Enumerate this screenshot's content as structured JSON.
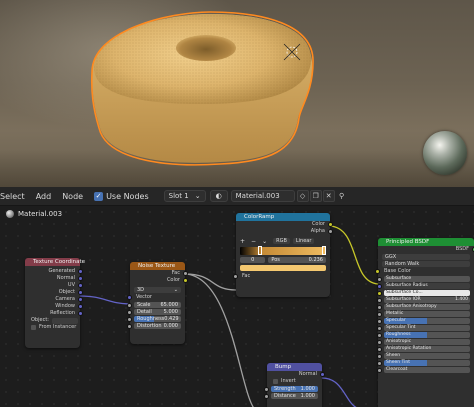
{
  "header": {
    "menus": [
      "Select",
      "Add",
      "Node"
    ],
    "use_nodes_label": "Use Nodes",
    "use_nodes_checked": true,
    "slot": "Slot 1",
    "material_name": "Material.003"
  },
  "breadcrumb": {
    "label": "Material.003"
  },
  "nodes": {
    "texcoord": {
      "title": "Texture Coordinate",
      "outputs": [
        "Generated",
        "Normal",
        "UV",
        "Object",
        "Camera",
        "Window",
        "Reflection"
      ],
      "object_label": "Object:",
      "from_instancer": "From Instancer"
    },
    "noise": {
      "title": "Noise Texture",
      "outputs": [
        "Fac",
        "Color"
      ],
      "dimension": "3D",
      "vector_label": "Vector",
      "fields": [
        {
          "label": "Scale",
          "value": "65.000"
        },
        {
          "label": "Detail",
          "value": "5.000"
        },
        {
          "label": "Roughness",
          "value": "0.429"
        },
        {
          "label": "Distortion",
          "value": "0.000"
        }
      ]
    },
    "colorramp": {
      "title": "ColorRamp",
      "outputs": [
        "Color",
        "Alpha"
      ],
      "plus": "+",
      "minus": "−",
      "menu": "⌄",
      "mode": "RGB",
      "interp": "Linear",
      "index": "0",
      "pos_label": "Pos",
      "pos_value": "0.236",
      "fac_label": "Fac",
      "stops": [
        0.236,
        1.0
      ]
    },
    "bsdf": {
      "title": "Principled BSDF",
      "output": "BSDF",
      "distribution": "GGX",
      "subsurface_method": "Random Walk",
      "base_color_label": "Base Color",
      "rows": [
        {
          "label": "Subsurface",
          "value": "",
          "fill": 0,
          "style": "plain"
        },
        {
          "label": "Subsurface Radius",
          "value": "",
          "fill": 0,
          "style": "dark"
        },
        {
          "label": "Subsurface Co...",
          "value": "",
          "fill": 0,
          "style": "white"
        },
        {
          "label": "Subsurface IOR",
          "value": "1.400",
          "fill": 0,
          "style": "plain"
        },
        {
          "label": "Subsurface Anisotropy",
          "value": "",
          "fill": 0,
          "style": "plain"
        },
        {
          "label": "Metallic",
          "value": "",
          "fill": 0,
          "style": "plain"
        },
        {
          "label": "Specular",
          "value": "",
          "fill": 50,
          "style": "blue"
        },
        {
          "label": "Specular Tint",
          "value": "",
          "fill": 0,
          "style": "plain"
        },
        {
          "label": "Roughness",
          "value": "",
          "fill": 50,
          "style": "blue"
        },
        {
          "label": "Anisotropic",
          "value": "",
          "fill": 0,
          "style": "plain"
        },
        {
          "label": "Anisotropic Rotation",
          "value": "",
          "fill": 0,
          "style": "plain"
        },
        {
          "label": "Sheen",
          "value": "",
          "fill": 0,
          "style": "plain"
        },
        {
          "label": "Sheen Tint",
          "value": "",
          "fill": 50,
          "style": "blue"
        },
        {
          "label": "Clearcoat",
          "value": "",
          "fill": 0,
          "style": "plain"
        }
      ]
    },
    "bump": {
      "title": "Bump",
      "output": "Normal",
      "invert": "Invert",
      "fields": [
        {
          "label": "Strength",
          "value": "1.000"
        },
        {
          "label": "Distance",
          "value": "1.000"
        }
      ]
    }
  },
  "colors": {
    "accent": "#4772b3",
    "selection_outline": "#ff8a1f",
    "donut": "#d9b26a"
  }
}
